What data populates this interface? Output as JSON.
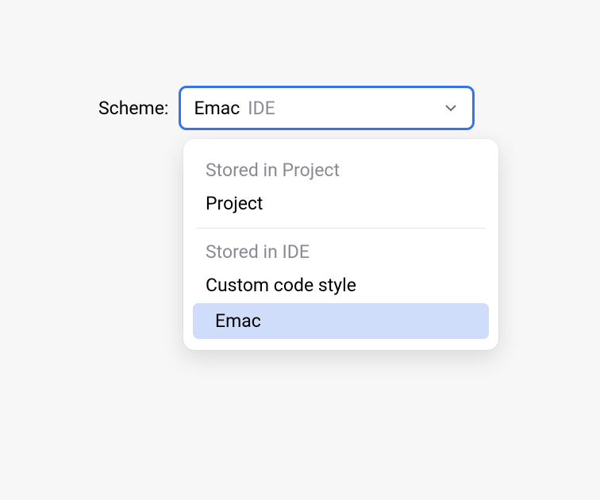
{
  "label": "Scheme:",
  "combobox": {
    "value": "Emac",
    "hint": "IDE"
  },
  "dropdown": {
    "groups": [
      {
        "header": "Stored in Project",
        "options": [
          {
            "label": "Project",
            "highlighted": false
          }
        ]
      },
      {
        "header": "Stored in IDE",
        "options": [
          {
            "label": "Custom code style",
            "highlighted": false
          },
          {
            "label": "Emac",
            "highlighted": true
          }
        ]
      }
    ]
  }
}
